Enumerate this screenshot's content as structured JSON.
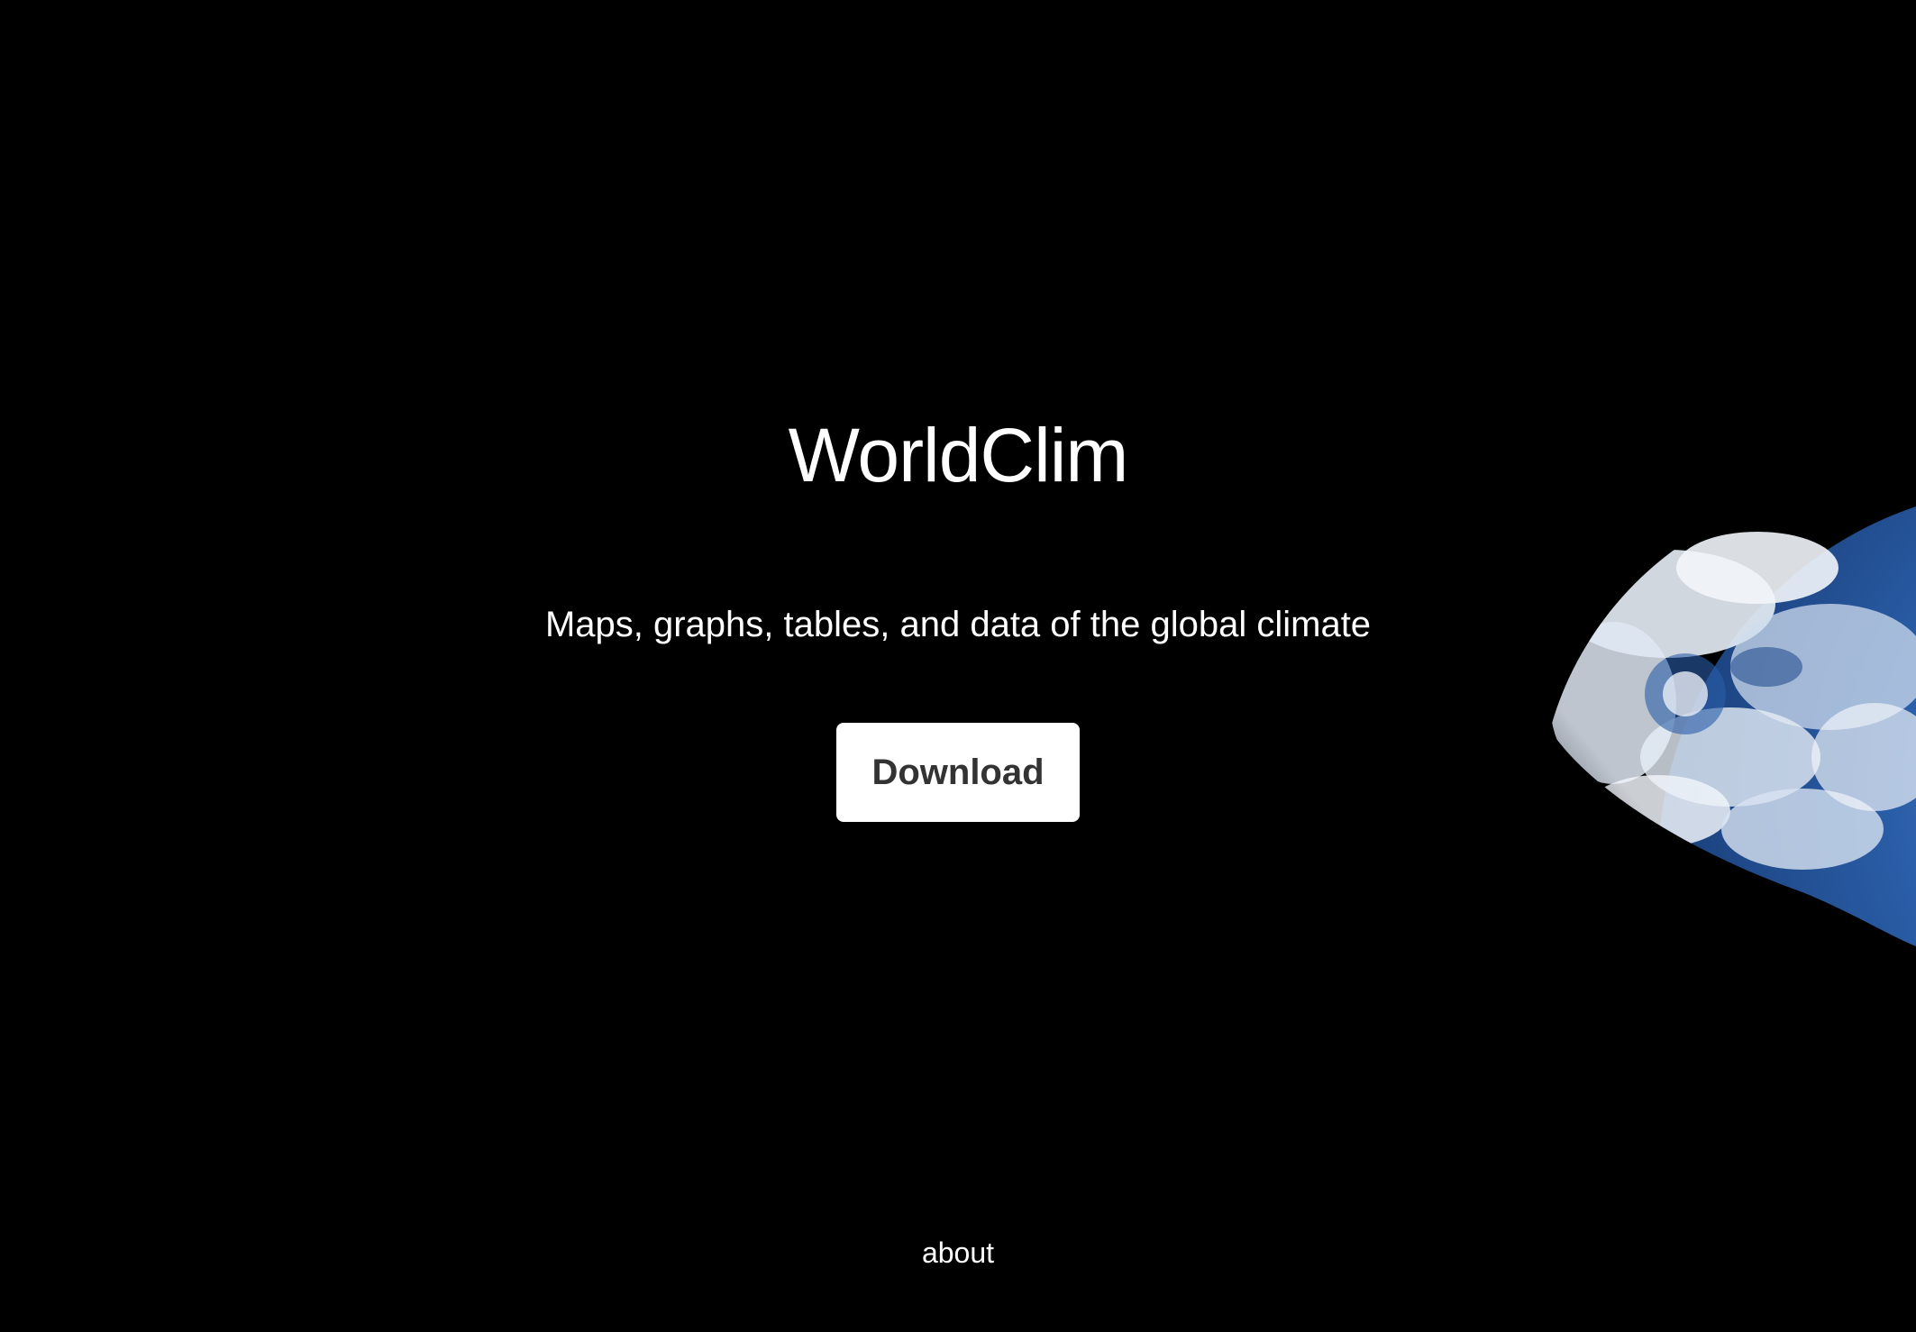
{
  "hero": {
    "title": "WorldClim",
    "subtitle": "Maps, graphs, tables, and data of the global climate",
    "download_label": "Download"
  },
  "footer": {
    "about_label": "about"
  },
  "colors": {
    "background": "#000000",
    "text": "#ffffff",
    "button_background": "#ffffff",
    "button_text": "#333333",
    "earth_ocean": "#2a5ea8",
    "earth_cloud": "#e8eef6"
  },
  "decor": {
    "earth_image": "earth-globe-image"
  }
}
